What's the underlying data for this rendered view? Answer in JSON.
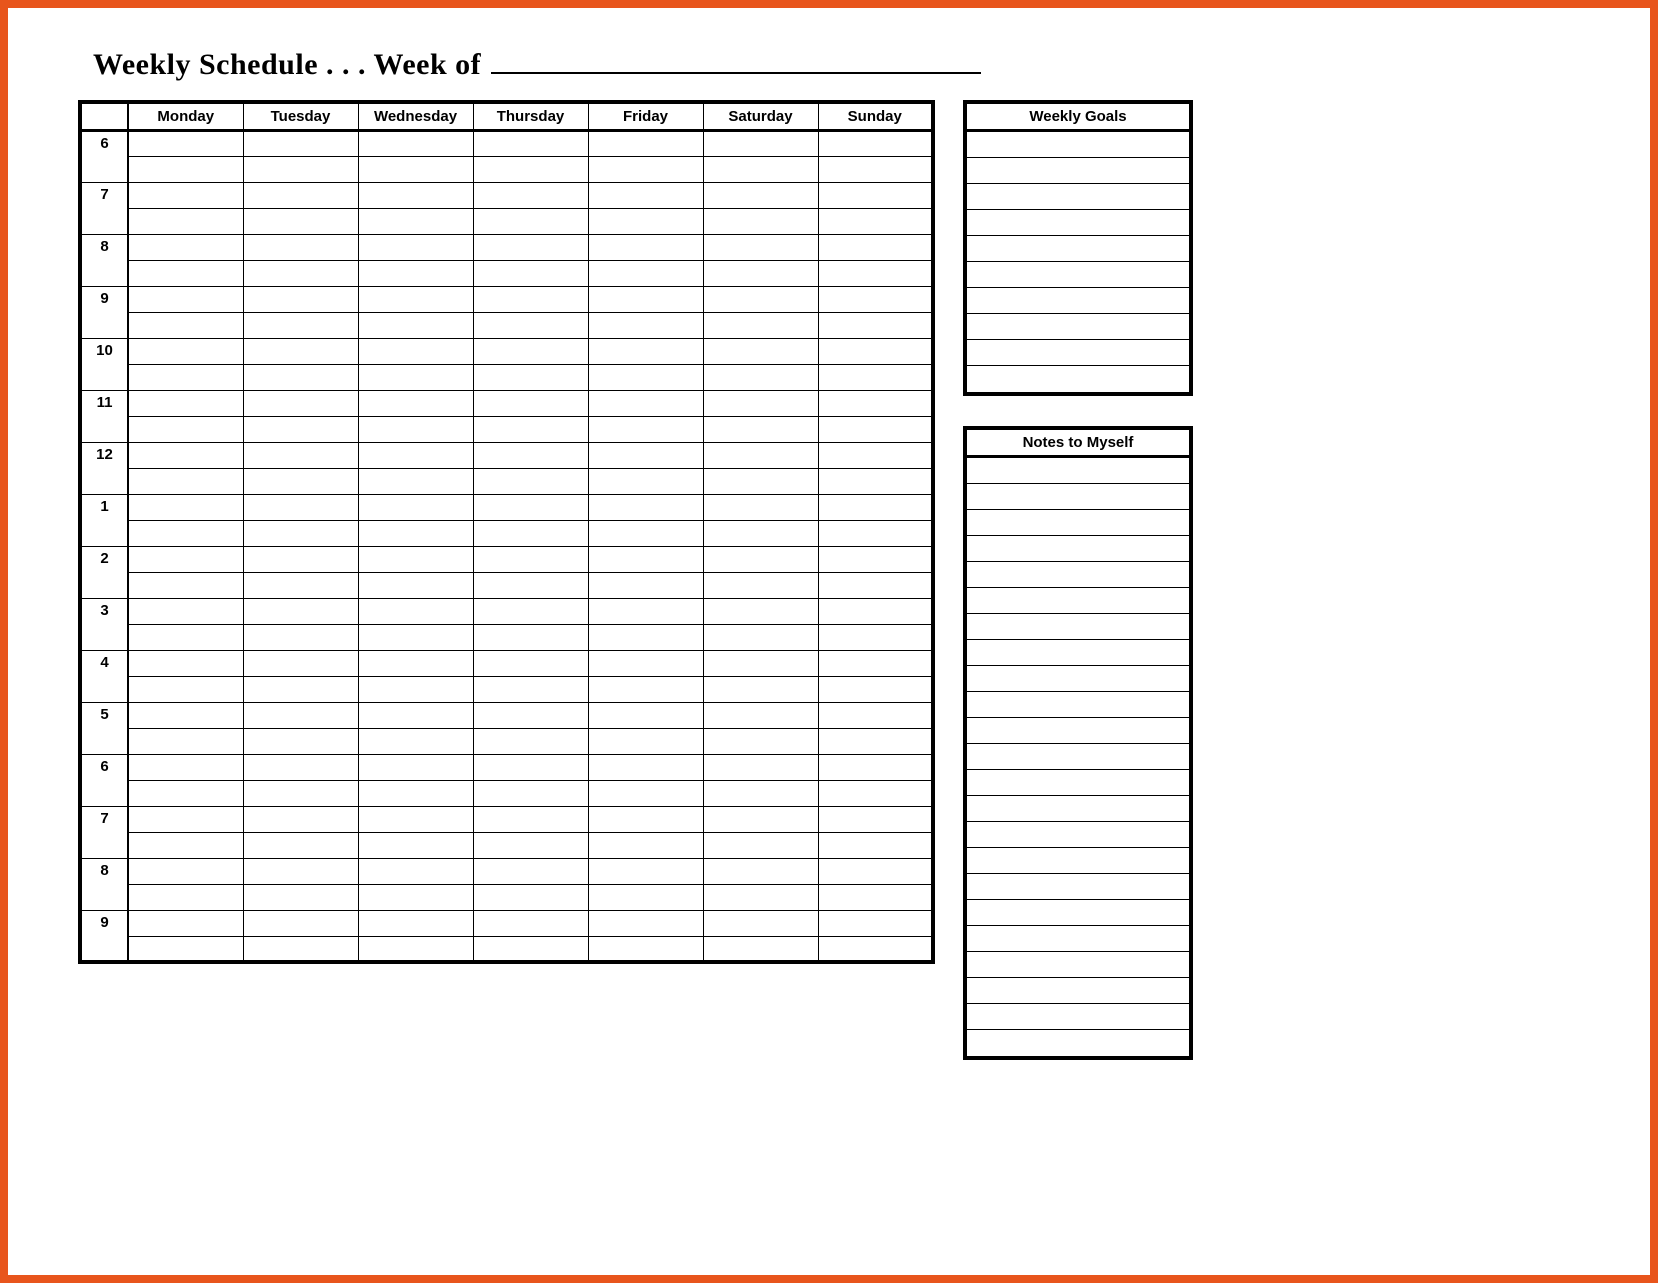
{
  "title": "Weekly Schedule . . . Week of",
  "week_of_value": "",
  "days": [
    "Monday",
    "Tuesday",
    "Wednesday",
    "Thursday",
    "Friday",
    "Saturday",
    "Sunday"
  ],
  "hours": [
    "6",
    "7",
    "8",
    "9",
    "10",
    "11",
    "12",
    "1",
    "2",
    "3",
    "4",
    "5",
    "6",
    "7",
    "8",
    "9"
  ],
  "sidebar": {
    "goals": {
      "header": "Weekly Goals",
      "lines": 10
    },
    "notes": {
      "header": "Notes to Myself",
      "lines": 23
    }
  }
}
